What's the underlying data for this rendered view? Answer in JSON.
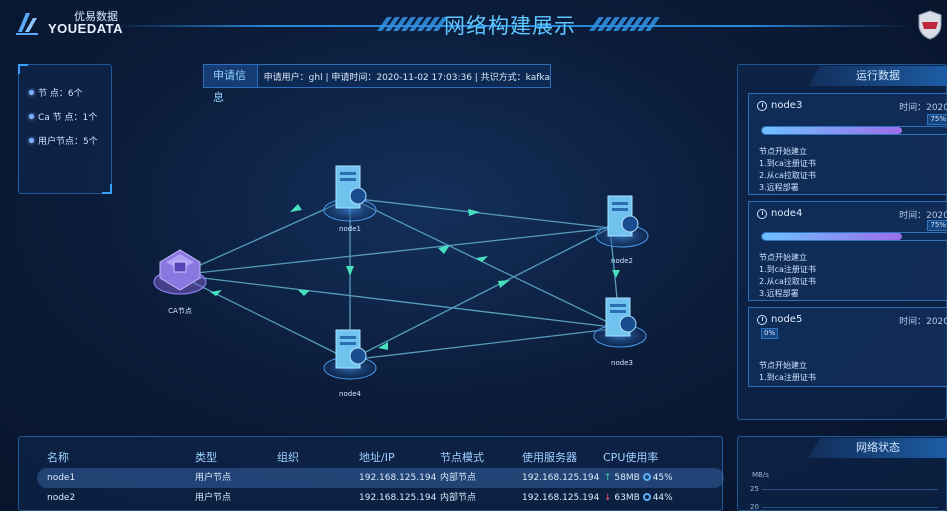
{
  "header": {
    "logo_cn": "优易数据",
    "logo_en": "YOUEDATA",
    "title": "网络构建展示"
  },
  "stats": {
    "items": [
      {
        "label": "节        点：6个"
      },
      {
        "label": "Ca 节 点：1个"
      },
      {
        "label": "用户节点：5个"
      }
    ]
  },
  "request": {
    "title": "申请信息",
    "detail": "申请用户：ghl  | 申请时间：2020-11-02 17:03:36  | 共识方式：kafka"
  },
  "graph": {
    "nodes": [
      {
        "id": "node1",
        "label": "node1",
        "type": "server"
      },
      {
        "id": "node2",
        "label": "node2",
        "type": "server"
      },
      {
        "id": "node3",
        "label": "node3",
        "type": "server"
      },
      {
        "id": "node4",
        "label": "node4",
        "type": "server"
      },
      {
        "id": "ca",
        "label": "CA节点",
        "type": "ca"
      }
    ]
  },
  "run_data": {
    "title": "运行数据",
    "cards": [
      {
        "name": "node3",
        "time": "时间：2020",
        "progress": 75,
        "progress_label": "75%",
        "steps": [
          "节点开始建立",
          "1.到ca注册证书",
          "2.从ca拉取证书",
          "3.远程部署"
        ]
      },
      {
        "name": "node4",
        "time": "时间：2020",
        "progress": 75,
        "progress_label": "75%",
        "steps": [
          "节点开始建立",
          "1.到ca注册证书",
          "2.从ca拉取证书",
          "3.远程部署"
        ]
      },
      {
        "name": "node5",
        "time": "时间：2020",
        "progress": 0,
        "progress_label": "0%",
        "steps": [
          "节点开始建立",
          "1.到ca注册证书"
        ]
      }
    ]
  },
  "table": {
    "headers": [
      "名称",
      "类型",
      "组织",
      "地址/IP",
      "节点模式",
      "使用服务器",
      "CPU使用率"
    ],
    "rows": [
      {
        "name": "node1",
        "type": "用户节点",
        "org": "",
        "ip": "192.168.125.194",
        "mode": "内部节点",
        "server": "192.168.125.194",
        "mem_dir": "↑",
        "mem": "58MB",
        "cpu": "45%"
      },
      {
        "name": "node2",
        "type": "用户节点",
        "org": "",
        "ip": "192.168.125.194",
        "mode": "内部节点",
        "server": "192.168.125.194",
        "mem_dir": "↓",
        "mem": "63MB",
        "cpu": "44%"
      }
    ]
  },
  "network_status": {
    "title": "网络状态",
    "unit": "MB/s",
    "ticks": [
      "25",
      "20"
    ]
  },
  "colors": {
    "accent": "#5ec8ff",
    "panel_border": "#1e5a9a",
    "up": "#44d7a8",
    "down": "#ff5a6a"
  }
}
